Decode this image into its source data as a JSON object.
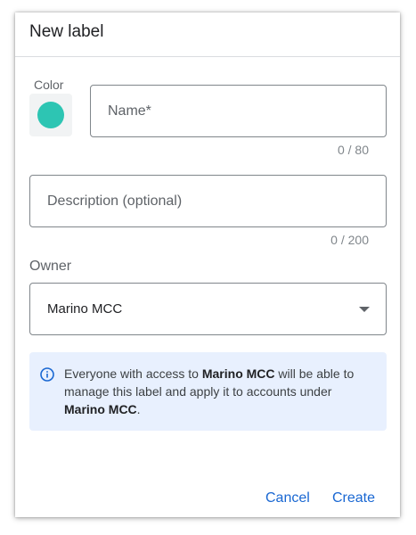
{
  "dialog": {
    "title": "New label"
  },
  "color": {
    "label": "Color",
    "selected_hex": "#2dc5b3"
  },
  "name_field": {
    "placeholder": "Name*",
    "value": "",
    "counter": "0 / 80"
  },
  "description_field": {
    "placeholder": "Description (optional)",
    "value": "",
    "counter": "0 / 200"
  },
  "owner": {
    "label": "Owner",
    "selected": "Marino MCC"
  },
  "info": {
    "icon": "info-icon",
    "text_1": "Everyone with access to ",
    "owner_1": "Marino MCC",
    "text_2": " will be able to manage this label and apply it to accounts under ",
    "owner_2": "Marino MCC",
    "text_3": "."
  },
  "actions": {
    "cancel_label": "Cancel",
    "create_label": "Create"
  },
  "colors": {
    "accent": "#1967d2",
    "info_bg": "#e8f0fe",
    "border": "#80868b"
  }
}
